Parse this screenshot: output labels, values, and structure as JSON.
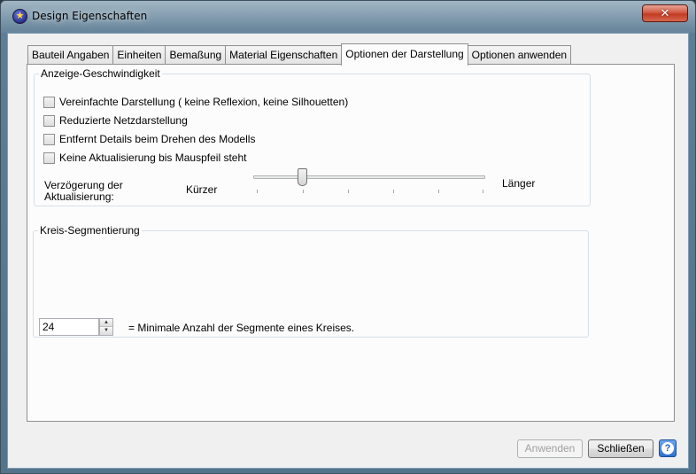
{
  "window": {
    "title": "Design Eigenschaften",
    "close_label": "✕"
  },
  "tabs": [
    {
      "label": "Bauteil Angaben"
    },
    {
      "label": "Einheiten"
    },
    {
      "label": "Bemaßung"
    },
    {
      "label": "Material Eigenschaften"
    },
    {
      "label": "Optionen der Darstellung",
      "active": true
    },
    {
      "label": "Optionen anwenden"
    }
  ],
  "speed_group": {
    "legend": "Anzeige-Geschwindigkeit",
    "options": [
      {
        "label": "Vereinfachte Darstellung ( keine Reflexion, keine Silhouetten)",
        "checked": false
      },
      {
        "label": "Reduzierte Netzdarstellung",
        "checked": false
      },
      {
        "label": "Entfernt Details beim Drehen des Modells",
        "checked": false
      },
      {
        "label": "Keine Aktualisierung bis Mauspfeil steht",
        "checked": false
      }
    ],
    "delay_label_1": "Verzögerung der",
    "delay_label_2": "Aktualisierung:",
    "slider_min_label": "Kürzer",
    "slider_max_label": "Länger",
    "slider_value_fraction": 0.2
  },
  "segment_group": {
    "legend": "Kreis-Segmentierung",
    "value": "24",
    "description": "= Minimale Anzahl der Segmente eines Kreises."
  },
  "footer": {
    "apply_label": "Anwenden",
    "close_label": "Schließen",
    "help_label": "?"
  }
}
